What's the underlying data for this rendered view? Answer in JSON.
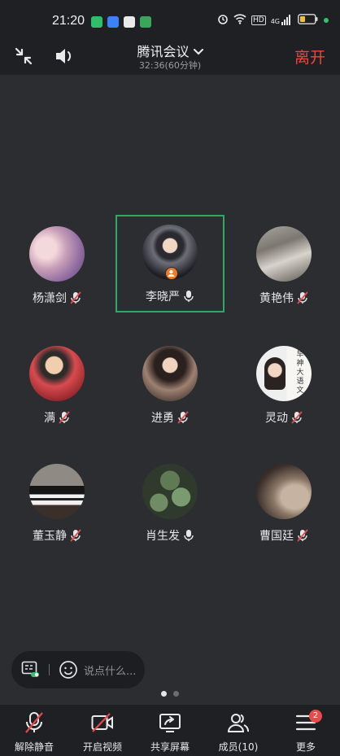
{
  "status_bar": {
    "time": "21:20",
    "network": "4G",
    "hd": "HD",
    "app_badges": [
      {
        "icon": "green-app-icon",
        "color": "#2fbf6a"
      },
      {
        "icon": "blue-app-icon",
        "color": "#3b82f6"
      },
      {
        "icon": "white-app-icon",
        "color": "#eaeaea"
      },
      {
        "icon": "green-square-app-icon",
        "color": "#3aa65c"
      }
    ],
    "battery_color": "#f2c230"
  },
  "header": {
    "title": "腾讯会议",
    "subtitle": "32:36(60分钟)",
    "leave_label": "离开"
  },
  "participants": [
    {
      "name": "杨潇剑",
      "mic": "muted"
    },
    {
      "name": "李晓严",
      "mic": "on",
      "active": true,
      "host": true
    },
    {
      "name": "黄艳伟",
      "mic": "muted"
    },
    {
      "name": "满",
      "mic": "muted"
    },
    {
      "name": "进勇",
      "mic": "muted"
    },
    {
      "name": "灵动",
      "mic": "muted"
    },
    {
      "name": "董玉静",
      "mic": "muted"
    },
    {
      "name": "肖生发",
      "mic": "on"
    },
    {
      "name": "曹国廷",
      "mic": "muted"
    }
  ],
  "avatar_text": {
    "lingdong": [
      "早",
      "神",
      "大",
      "语",
      "文"
    ]
  },
  "chat": {
    "placeholder": "说点什么..."
  },
  "pager": {
    "pages": 2,
    "current": 1
  },
  "toolbar": {
    "unmute_label": "解除静音",
    "video_label": "开启视频",
    "share_label": "共享屏幕",
    "members_label": "成员(10)",
    "more_label": "更多",
    "more_badge": "2"
  },
  "colors": {
    "accent_green": "#2ea865",
    "leave_red": "#f0453f",
    "mute_red": "#e5484d",
    "badge_red": "#e94b4b"
  }
}
